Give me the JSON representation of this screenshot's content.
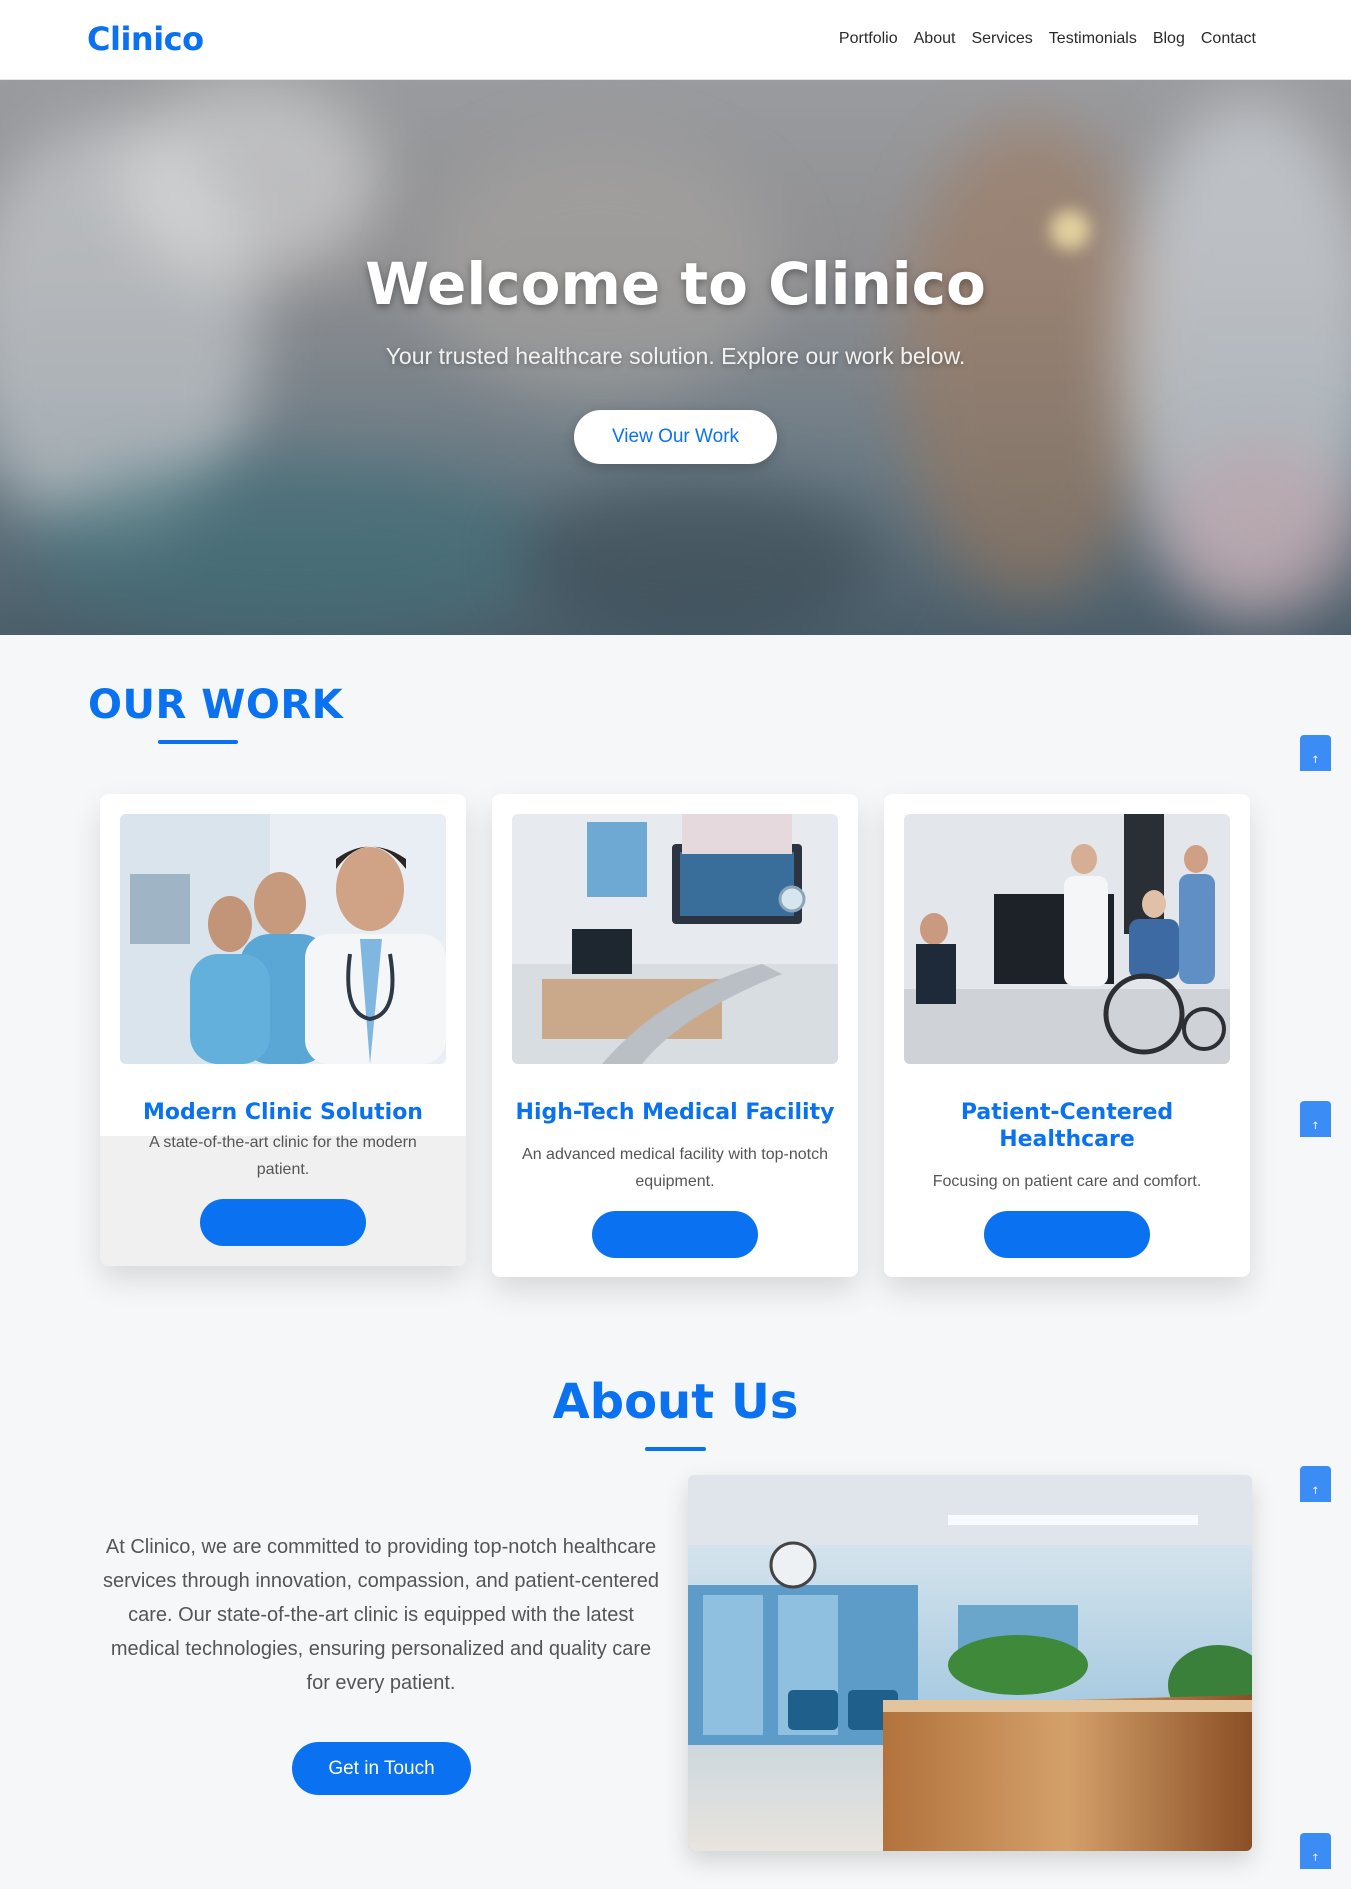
{
  "header": {
    "logo": "Clinico",
    "nav": [
      "Portfolio",
      "About",
      "Services",
      "Testimonials",
      "Blog",
      "Contact"
    ]
  },
  "hero": {
    "title": "Welcome to Clinico",
    "subtitle": "Your trusted healthcare solution. Explore our work below.",
    "button": "View Our Work"
  },
  "work": {
    "title": "OUR WORK",
    "cards": [
      {
        "title": "Modern Clinic Solution",
        "description": "A state-of-the-art clinic for the modern patient."
      },
      {
        "title": "High-Tech Medical Facility",
        "description": "An advanced medical facility with top-notch equipment."
      },
      {
        "title": "Patient-Centered Healthcare",
        "description": "Focusing on patient care and comfort."
      }
    ]
  },
  "about": {
    "title": "About Us",
    "text": "At Clinico, we are committed to providing top-notch healthcare services through innovation, compassion, and patient-centered care. Our state-of-the-art clinic is equipped with the latest medical technologies, ensuring personalized and quality care for every patient.",
    "button": "Get in Touch"
  },
  "scroll_tab_glyph": "↑",
  "colors": {
    "accent": "#0a72f0",
    "scroll_tab": "#3b8df5"
  }
}
